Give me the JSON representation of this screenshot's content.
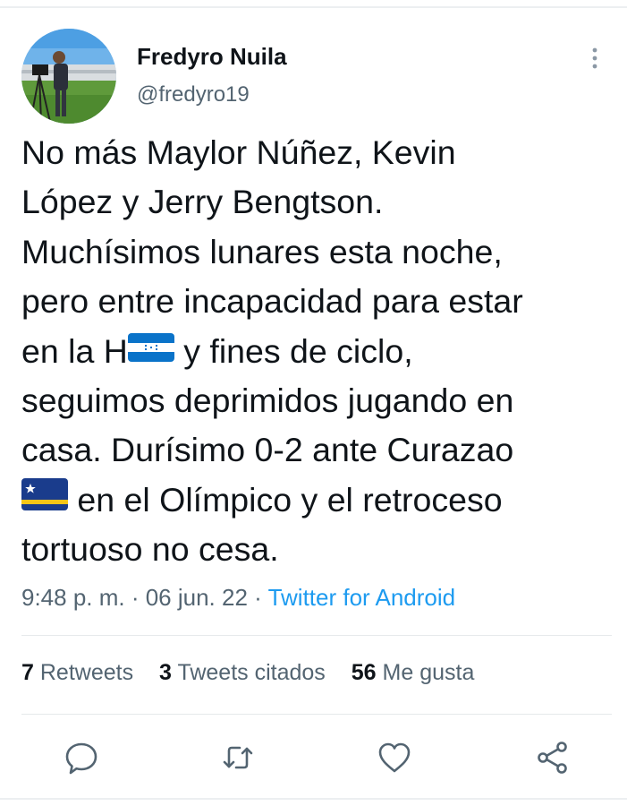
{
  "tweet": {
    "author": {
      "name": "Fredyro Nuila",
      "handle": "@fredyro19"
    },
    "text_lines": [
      "No más Maylor Núñez, Kevin",
      "López y Jerry Bengtson.",
      "Muchísimos lunares esta noche,",
      "pero entre incapacidad para estar",
      [
        "en la H",
        " y fines de ciclo,"
      ],
      "seguimos deprimidos jugando en",
      "casa. Durísimo 0-2 ante Curazao",
      [
        "",
        " en el Olímpico y el retroceso"
      ],
      "tortuoso no cesa."
    ],
    "emoji": [
      "flag-honduras",
      "flag-curacao"
    ],
    "timestamp": "9:48 p. m. · 06 jun. 22 · ",
    "source": "Twitter for Android"
  },
  "stats": {
    "retweets_count": "7",
    "retweets_label": "Retweets",
    "quotes_count": "3",
    "quotes_label": "Tweets citados",
    "likes_count": "56",
    "likes_label": "Me gusta"
  },
  "icons": [
    "reply-icon",
    "retweet-icon",
    "like-icon",
    "share-icon",
    "more-icon"
  ],
  "colors": {
    "link": "#1d9bf0",
    "secondary": "#536471",
    "text": "#0f1419"
  }
}
